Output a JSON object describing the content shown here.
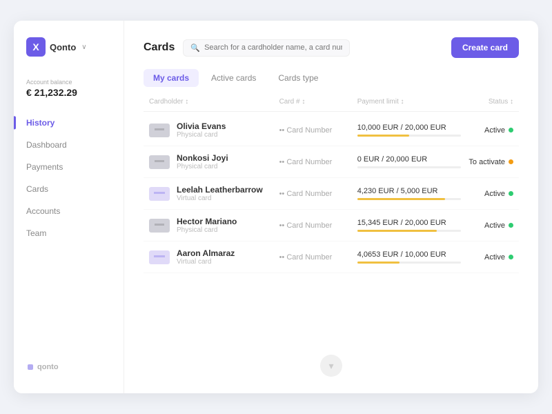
{
  "sidebar": {
    "logo": {
      "icon_letter": "X",
      "name": "Qonto",
      "chevron": "∨"
    },
    "account_balance_label": "Account balance",
    "account_balance_amount": "€ 21,232.29",
    "nav_items": [
      {
        "id": "history",
        "label": "History",
        "active": true
      },
      {
        "id": "dashboard",
        "label": "Dashboard",
        "active": false
      },
      {
        "id": "payments",
        "label": "Payments",
        "active": false
      },
      {
        "id": "cards",
        "label": "Cards",
        "active": false
      },
      {
        "id": "accounts",
        "label": "Accounts",
        "active": false
      },
      {
        "id": "team",
        "label": "Team",
        "active": false
      }
    ],
    "bottom_logo": "qonto"
  },
  "header": {
    "page_title": "Cards",
    "search_placeholder": "Search for a cardholder name, a card number...",
    "create_card_button": "Create card"
  },
  "tabs": [
    {
      "id": "my-cards",
      "label": "My cards",
      "active": true
    },
    {
      "id": "active-cards",
      "label": "Active cards",
      "active": false
    },
    {
      "id": "cards-type",
      "label": "Cards type",
      "active": false
    }
  ],
  "table": {
    "columns": [
      {
        "id": "cardholder",
        "label": "Cardholder ↕"
      },
      {
        "id": "card-number",
        "label": "Card # ↕"
      },
      {
        "id": "payment-limit",
        "label": "Payment limit ↕"
      },
      {
        "id": "status",
        "label": "Status ↕"
      }
    ],
    "rows": [
      {
        "id": 1,
        "holder_name": "Olivia Evans",
        "card_type": "Physical card",
        "card_icon_type": "physical",
        "card_number": "•• Card Number",
        "limit_text": "10,000 EUR / 20,000 EUR",
        "limit_pct": 50,
        "status": "Active",
        "status_dot": "green"
      },
      {
        "id": 2,
        "holder_name": "Nonkosi Joyi",
        "card_type": "Physical card",
        "card_icon_type": "physical",
        "card_number": "•• Card Number",
        "limit_text": "0 EUR / 20,000 EUR",
        "limit_pct": 0,
        "status": "To activate",
        "status_dot": "orange"
      },
      {
        "id": 3,
        "holder_name": "Leelah Leatherbarrow",
        "card_type": "Virtual card",
        "card_icon_type": "virtual",
        "card_number": "•• Card Number",
        "limit_text": "4,230 EUR / 5,000 EUR",
        "limit_pct": 85,
        "status": "Active",
        "status_dot": "green"
      },
      {
        "id": 4,
        "holder_name": "Hector Mariano",
        "card_type": "Physical card",
        "card_icon_type": "physical",
        "card_number": "•• Card Number",
        "limit_text": "15,345 EUR / 20,000 EUR",
        "limit_pct": 77,
        "status": "Active",
        "status_dot": "green"
      },
      {
        "id": 5,
        "holder_name": "Aaron Almaraz",
        "card_type": "Virtual card",
        "card_icon_type": "virtual",
        "card_number": "•• Card Number",
        "limit_text": "4,0653 EUR / 10,000 EUR",
        "limit_pct": 41,
        "status": "Active",
        "status_dot": "green"
      }
    ]
  }
}
